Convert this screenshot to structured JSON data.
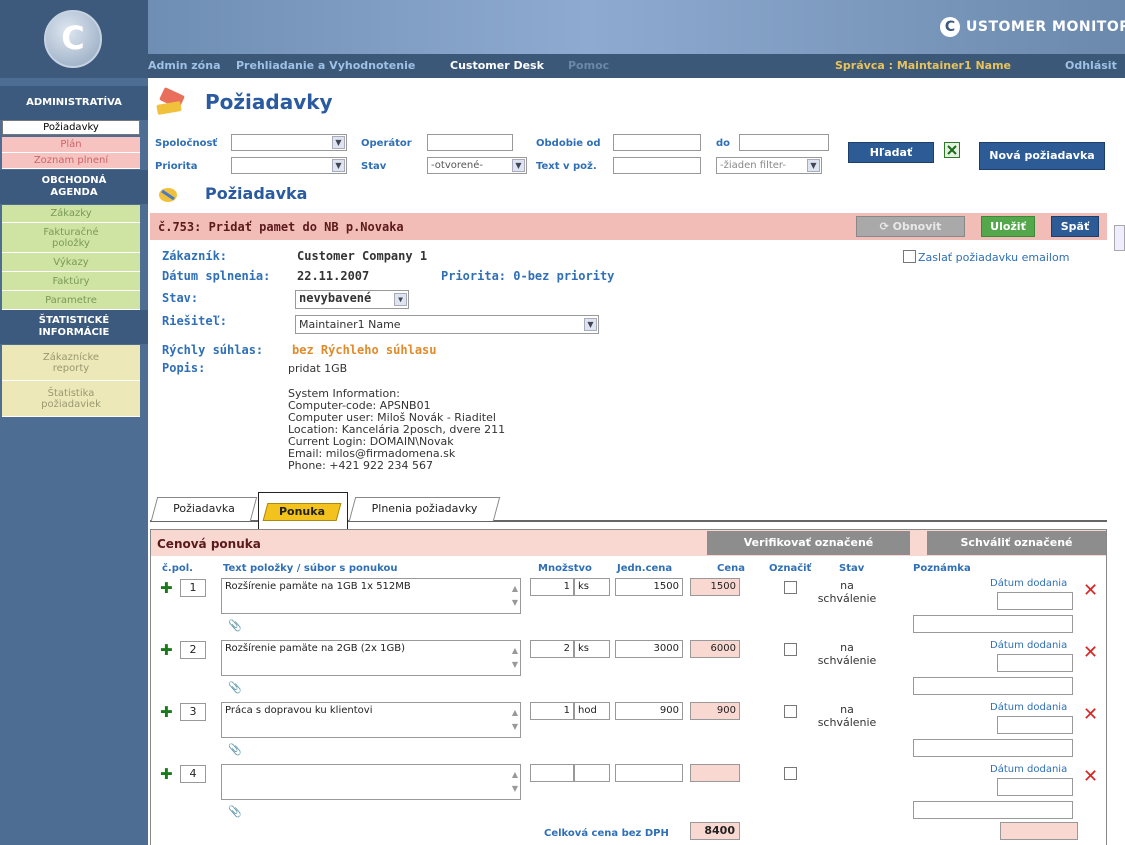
{
  "header": {
    "logo_letter": "C",
    "brand": "USTOMER MONITOR",
    "brand_letter": "C"
  },
  "nav": {
    "items": [
      "Admin zóna",
      "Prehliadanie a Vyhodnotenie",
      "Customer Desk",
      "Pomoc"
    ],
    "user": "Správca : Maintainer1 Name",
    "logout": "Odhlásit"
  },
  "sidebar": {
    "head1": "ADMINISTRATÍVA",
    "group1": [
      "Požiadavky",
      "Plán",
      "Zoznam plnení"
    ],
    "head2": "OBCHODNÁ AGENDA",
    "group2": [
      "Zákazky",
      "Fakturačné položky",
      "Výkazy",
      "Faktúry",
      "Parametre"
    ],
    "head3": "ŠTATISTICKÉ INFORMÁCIE",
    "group3": [
      "Zákaznícke reporty",
      "Štatistika požiadaviek"
    ]
  },
  "page": {
    "title": "Požiadavky"
  },
  "filter": {
    "spolocnost_label": "Spoločnosť",
    "operator_label": "Operátor",
    "obdobie_label": "Obdobie od",
    "do_label": "do",
    "priorita_label": "Priorita",
    "stav_label": "Stav",
    "stav_value": "-otvorené-",
    "text_label": "Text v pož.",
    "filter_value": "-žiaden filter-",
    "search_btn": "Hľadať",
    "new_btn": "Nová požiadavka"
  },
  "detail": {
    "section_title": "Požiadavka",
    "request_title": "č.753:  Pridať pamet do NB p.Novaka",
    "refresh_btn": "Obnovit",
    "save_btn": "Uložiť",
    "back_btn": "Späť",
    "customer_label": "Zákazník:",
    "customer_value": "Customer Company 1",
    "date_label": "Dátum splnenia:",
    "date_value": "22.11.2007",
    "priority_text": "Priorita: 0-bez priority",
    "email_label": "Zaslať požiadavku emailom",
    "stav_label": "Stav:",
    "stav_value": "nevybavené",
    "solver_label": "Riešiteľ:",
    "solver_value": "Maintainer1 Name",
    "quick_label": "Rýchly súhlas:",
    "quick_value": "bez Rýchleho súhlasu",
    "popis_label": "Popis:",
    "popis_short": "pridat 1GB",
    "description": "System Information:\nComputer-code: APSNB01\nComputer user: Miloš Novák - Riaditel\nLocation: Kancelária 2posch, dvere 211\nCurrent Login: DOMAIN\\Novak\nEmail: milos@firmadomena.sk\nPhone: +421 922 234 567"
  },
  "tabs": [
    "Požiadavka",
    "Ponuka",
    "Plnenia požiadavky"
  ],
  "offer": {
    "title": "Cenová ponuka",
    "verify_btn": "Verifikovať označené",
    "approve_btn": "Schváliť označené",
    "headers": [
      "č.pol.",
      "Text položky / súbor s ponukou",
      "Množstvo",
      "Jedn.cena",
      "Cena",
      "Označiť",
      "Stav",
      "Poznámka"
    ],
    "date_label": "Dátum dodania",
    "rows": [
      {
        "num": "1",
        "text": "Rozšírenie pamäte na 1GB 1x 512MB",
        "qty": "1",
        "unit": "ks",
        "unit_price": "1500",
        "price": "1500",
        "stav": "na schválenie"
      },
      {
        "num": "2",
        "text": "Rozšírenie pamäte na 2GB (2x 1GB)",
        "qty": "2",
        "unit": "ks",
        "unit_price": "3000",
        "price": "6000",
        "stav": "na schválenie"
      },
      {
        "num": "3",
        "text": "Práca s dopravou ku klientovi",
        "qty": "1",
        "unit": "hod",
        "unit_price": "900",
        "price": "900",
        "stav": "na schválenie"
      },
      {
        "num": "4",
        "text": "",
        "qty": "",
        "unit": "",
        "unit_price": "",
        "price": "",
        "stav": ""
      }
    ],
    "total_label": "Celková cena bez DPH",
    "total_value": "8400"
  }
}
